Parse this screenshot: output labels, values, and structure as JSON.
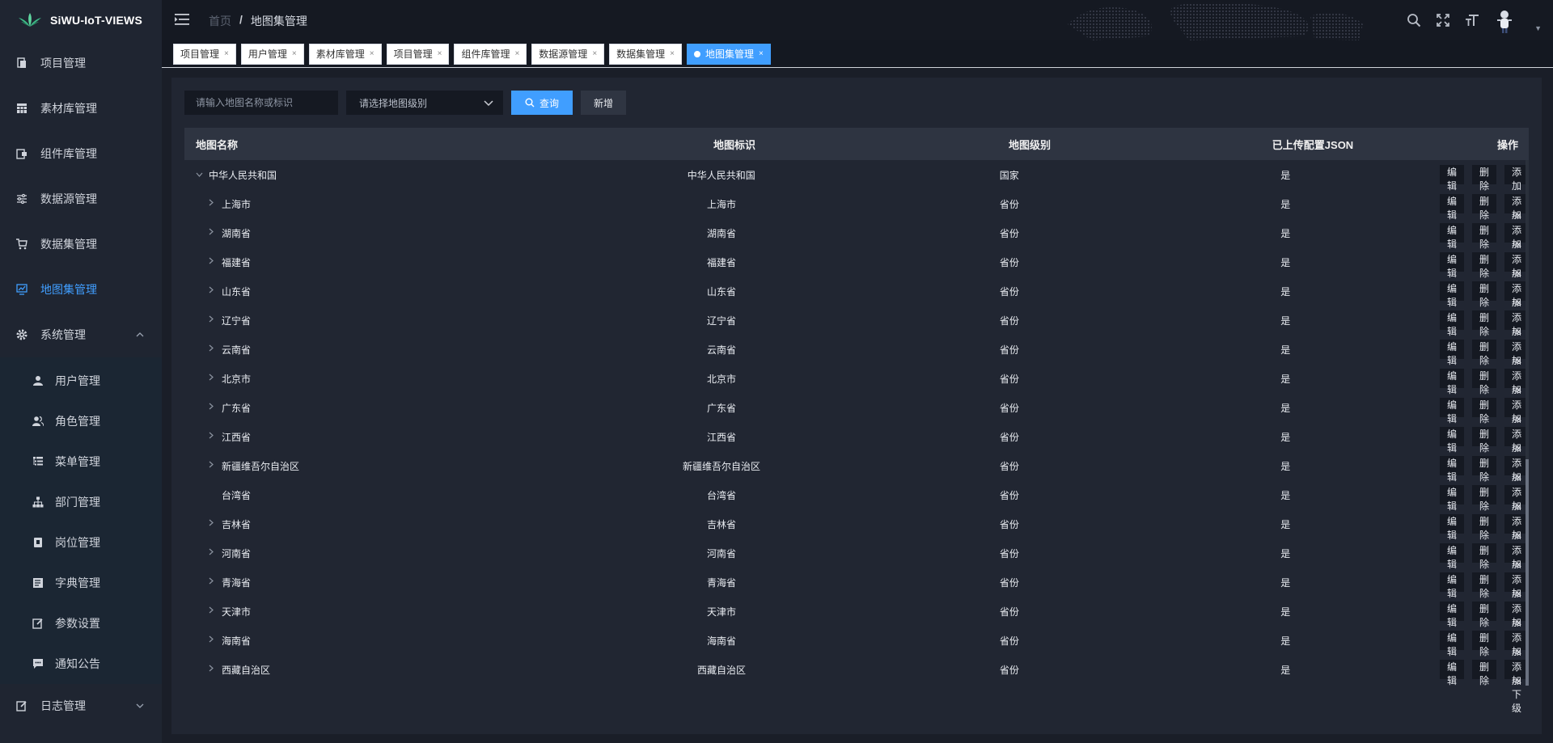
{
  "app": {
    "title": "SiWU-IoT-VIEWS"
  },
  "sidebar": {
    "items": [
      {
        "label": "项目管理",
        "icon": "document-icon"
      },
      {
        "label": "素材库管理",
        "icon": "grid-icon"
      },
      {
        "label": "组件库管理",
        "icon": "component-icon"
      },
      {
        "label": "数据源管理",
        "icon": "sliders-icon"
      },
      {
        "label": "数据集管理",
        "icon": "cart-icon"
      },
      {
        "label": "地图集管理",
        "icon": "monitor-chart-icon",
        "active": true
      },
      {
        "label": "系统管理",
        "icon": "gear-icon",
        "expanded": true
      }
    ],
    "sub_items": [
      {
        "label": "用户管理",
        "icon": "user-icon"
      },
      {
        "label": "角色管理",
        "icon": "users-icon"
      },
      {
        "label": "菜单管理",
        "icon": "list-tree-icon"
      },
      {
        "label": "部门管理",
        "icon": "org-chart-icon"
      },
      {
        "label": "岗位管理",
        "icon": "badge-icon"
      },
      {
        "label": "字典管理",
        "icon": "book-icon"
      },
      {
        "label": "参数设置",
        "icon": "edit-icon"
      },
      {
        "label": "通知公告",
        "icon": "message-icon"
      }
    ],
    "log_item": {
      "label": "日志管理",
      "icon": "edit-icon"
    }
  },
  "header": {
    "breadcrumb_home": "首页",
    "breadcrumb_sep": "/",
    "breadcrumb_current": "地图集管理"
  },
  "tabs": [
    {
      "label": "项目管理"
    },
    {
      "label": "用户管理"
    },
    {
      "label": "素材库管理"
    },
    {
      "label": "项目管理"
    },
    {
      "label": "组件库管理"
    },
    {
      "label": "数据源管理"
    },
    {
      "label": "数据集管理"
    },
    {
      "label": "地图集管理",
      "active": true
    }
  ],
  "tab_close": "×",
  "search": {
    "placeholder": "请输入地图名称或标识",
    "level_placeholder": "请选择地图级别",
    "query_label": "查询",
    "add_label": "新增"
  },
  "table": {
    "headers": {
      "name": "地图名称",
      "code": "地图标识",
      "level": "地图级别",
      "json": "已上传配置JSON",
      "ops": "操作"
    },
    "op_labels": {
      "edit": "编辑",
      "delete": "删除",
      "add_child": "添加下级"
    },
    "rows": [
      {
        "name": "中华人民共和国",
        "code": "中华人民共和国",
        "level": "国家",
        "json": "是",
        "root": true,
        "expanded": true
      },
      {
        "name": "上海市",
        "code": "上海市",
        "level": "省份",
        "json": "是"
      },
      {
        "name": "湖南省",
        "code": "湖南省",
        "level": "省份",
        "json": "是"
      },
      {
        "name": "福建省",
        "code": "福建省",
        "level": "省份",
        "json": "是"
      },
      {
        "name": "山东省",
        "code": "山东省",
        "level": "省份",
        "json": "是"
      },
      {
        "name": "辽宁省",
        "code": "辽宁省",
        "level": "省份",
        "json": "是"
      },
      {
        "name": "云南省",
        "code": "云南省",
        "level": "省份",
        "json": "是"
      },
      {
        "name": "北京市",
        "code": "北京市",
        "level": "省份",
        "json": "是"
      },
      {
        "name": "广东省",
        "code": "广东省",
        "level": "省份",
        "json": "是"
      },
      {
        "name": "江西省",
        "code": "江西省",
        "level": "省份",
        "json": "是"
      },
      {
        "name": "新疆维吾尔自治区",
        "code": "新疆维吾尔自治区",
        "level": "省份",
        "json": "是"
      },
      {
        "name": "台湾省",
        "code": "台湾省",
        "level": "省份",
        "json": "是",
        "no_caret": true
      },
      {
        "name": "吉林省",
        "code": "吉林省",
        "level": "省份",
        "json": "是"
      },
      {
        "name": "河南省",
        "code": "河南省",
        "level": "省份",
        "json": "是"
      },
      {
        "name": "青海省",
        "code": "青海省",
        "level": "省份",
        "json": "是"
      },
      {
        "name": "天津市",
        "code": "天津市",
        "level": "省份",
        "json": "是"
      },
      {
        "name": "海南省",
        "code": "海南省",
        "level": "省份",
        "json": "是"
      },
      {
        "name": "西藏自治区",
        "code": "西藏自治区",
        "level": "省份",
        "json": "是"
      }
    ]
  },
  "colors": {
    "accent": "#409eff",
    "sidebar_bg": "#1f2531",
    "main_bg": "#212632"
  }
}
